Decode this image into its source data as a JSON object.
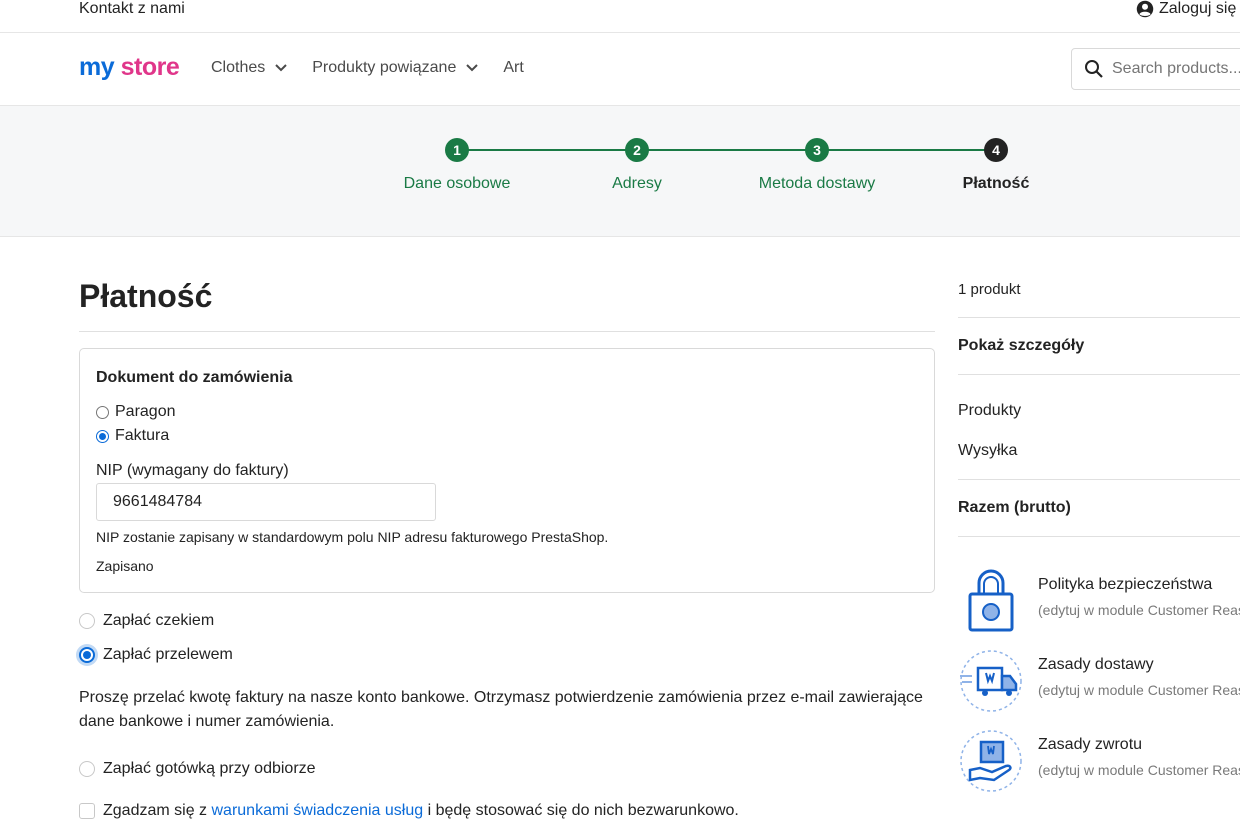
{
  "topbar": {
    "contact": "Kontakt z nami",
    "login": "Zaloguj się",
    "login_icon": "user-circle-icon"
  },
  "header": {
    "logo": {
      "text_part1": "my",
      "text_part2": "store"
    },
    "nav": [
      {
        "label": "Clothes",
        "has_dropdown": true
      },
      {
        "label": "Produkty powiązane",
        "has_dropdown": true
      },
      {
        "label": "Art",
        "has_dropdown": false
      }
    ],
    "search": {
      "placeholder": "Search products...",
      "icon": "search-icon"
    }
  },
  "stepper": {
    "steps": [
      {
        "number": "1",
        "label": "Dane osobowe",
        "state": "complete"
      },
      {
        "number": "2",
        "label": "Adresy",
        "state": "complete"
      },
      {
        "number": "3",
        "label": "Metoda dostawy",
        "state": "complete"
      },
      {
        "number": "4",
        "label": "Płatność",
        "state": "active"
      }
    ],
    "colors": {
      "complete": "#1a7a45",
      "active": "#232323"
    }
  },
  "main": {
    "title": "Płatność",
    "document": {
      "heading": "Dokument do zamówienia",
      "options": [
        {
          "label": "Paragon",
          "selected": false
        },
        {
          "label": "Faktura",
          "selected": true
        }
      ],
      "nip_label": "NIP (wymagany do faktury)",
      "nip_value": "9661484784",
      "hint": "NIP zostanie zapisany w standardowym polu NIP adresu fakturowego PrestaShop.",
      "status": "Zapisano"
    },
    "payment_options": [
      {
        "label": "Zapłać czekiem",
        "selected": false
      },
      {
        "label": "Zapłać przelewem",
        "selected": true
      },
      {
        "label": "Zapłać gotówką przy odbiorze",
        "selected": false
      }
    ],
    "transfer_info": "Proszę przelać kwotę faktury na nasze konto bankowe. Otrzymasz potwierdzenie zamówienia przez e-mail zawierające dane bankowe i numer zamówienia.",
    "terms": {
      "prefix": "Zgadzam się z ",
      "link": "warunkami świadczenia usług",
      "suffix": " i będę stosować się do nich bezwarunkowo.",
      "checked": false
    }
  },
  "sidebar": {
    "count": "1 produkt",
    "details": "Pokaż szczegóły",
    "products": "Produkty",
    "shipping": "Wysyłka",
    "total": "Razem (brutto)",
    "reassurance": [
      {
        "title": "Polityka bezpieczeństwa",
        "subtitle": "(edytuj w module Customer Reassurance)",
        "icon": "padlock-icon"
      },
      {
        "title": "Zasady dostawy",
        "subtitle": "(edytuj w module Customer Reassurance)",
        "icon": "delivery-truck-icon"
      },
      {
        "title": "Zasady zwrotu",
        "subtitle": "(edytuj w module Customer Reassurance)",
        "icon": "return-box-icon"
      }
    ]
  },
  "colors": {
    "accent": "#0b6bd8",
    "success": "#1a7a45",
    "text": "#232323"
  }
}
